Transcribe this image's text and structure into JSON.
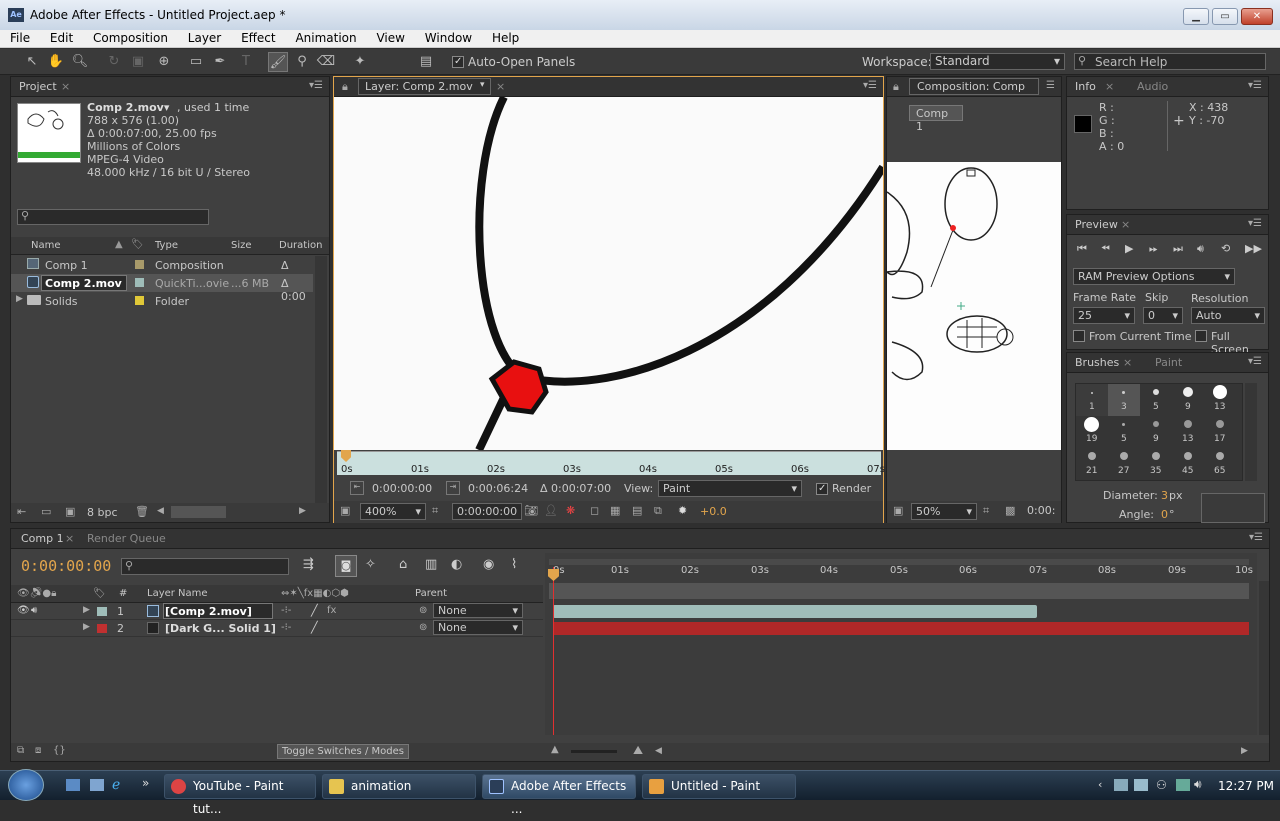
{
  "window": {
    "title": "Adobe After Effects - Untitled Project.aep *",
    "app_icon": "Ae"
  },
  "menu": [
    "File",
    "Edit",
    "Composition",
    "Layer",
    "Effect",
    "Animation",
    "View",
    "Window",
    "Help"
  ],
  "toolbar": {
    "auto_open_label": "Auto-Open Panels",
    "workspace_label": "Workspace:",
    "workspace_value": "Standard",
    "search_placeholder": "Search Help"
  },
  "project": {
    "tab": "Project",
    "item_name": "Comp 2.mov▾",
    "item_used": ", used 1 time",
    "info_lines": [
      "788 x 576 (1.00)",
      "Δ 0:00:07:00, 25.00 fps",
      "Millions of Colors",
      "MPEG-4 Video",
      "48.000 kHz / 16 bit U / Stereo"
    ],
    "columns": [
      "Name",
      "Type",
      "Size",
      "Duration"
    ],
    "rows": [
      {
        "name": "Comp 1",
        "type": "Composition",
        "size": "",
        "duration": "Δ 0:00",
        "color": "#a89a6a"
      },
      {
        "name": "Comp 2.mov",
        "type": "QuickTi...ovie",
        "size": "...6 MB",
        "duration": "Δ 0:00",
        "color": "#9fbdb9"
      },
      {
        "name": "Solids",
        "type": "Folder",
        "size": "",
        "duration": "",
        "color": "#e0c838"
      }
    ],
    "bpc": "8 bpc"
  },
  "layer_viewer": {
    "tab": "Layer: Comp 2.mov",
    "ruler": [
      "0s",
      "01s",
      "02s",
      "03s",
      "04s",
      "05s",
      "06s",
      "07s"
    ],
    "in_time": "0:00:00:00",
    "out_time": "0:00:06:24",
    "duration": "Δ 0:00:07:00",
    "view_label": "View:",
    "view_value": "Paint",
    "render_label": "Render",
    "zoom": "400%",
    "current_time": "0:00:00:00",
    "exposure": "+0.0"
  },
  "comp_viewer": {
    "tab": "Composition: Comp",
    "comp_button": "Comp 1",
    "zoom": "50%",
    "time": "0:00:"
  },
  "info": {
    "tab": "Info",
    "tab2": "Audio",
    "r": "R :",
    "g": "G :",
    "b": "B :",
    "a": "A : 0",
    "x": "X : 438",
    "y": "Y : -70"
  },
  "preview": {
    "tab": "Preview",
    "ram_options": "RAM Preview Options",
    "frame_rate_label": "Frame Rate",
    "skip_label": "Skip",
    "resolution_label": "Resolution",
    "frame_rate": "25",
    "skip": "0",
    "resolution": "Auto",
    "from_current_label": "From Current Time",
    "full_screen_label": "Full Screen"
  },
  "brushes": {
    "tab": "Brushes",
    "tab2": "Paint",
    "sizes": [
      "1",
      "3",
      "5",
      "9",
      "13",
      "19",
      "5",
      "9",
      "13",
      "17",
      "21",
      "27",
      "35",
      "45",
      "65"
    ],
    "diameter_label": "Diameter:",
    "diameter_value": "3",
    "diameter_unit": "px",
    "angle_label": "Angle:",
    "angle_value": "0",
    "angle_unit": "°"
  },
  "timeline": {
    "tab": "Comp 1",
    "tab2": "Render Queue",
    "timecode": "0:00:00:00",
    "col_num": "#",
    "col_layer": "Layer Name",
    "col_parent": "Parent",
    "ruler": [
      "0s",
      "01s",
      "02s",
      "03s",
      "04s",
      "05s",
      "06s",
      "07s",
      "08s",
      "09s",
      "10s"
    ],
    "layers": [
      {
        "num": "1",
        "name": "[Comp 2.mov]",
        "parent": "None",
        "color": "#9fbdb9"
      },
      {
        "num": "2",
        "name": "[Dark G... Solid 1]",
        "parent": "None",
        "color": "#c03030"
      }
    ],
    "toggle_label": "Toggle Switches / Modes"
  },
  "taskbar": {
    "items": [
      {
        "label": "YouTube - Paint tut...",
        "color": "#d44"
      },
      {
        "label": "animation",
        "color": "#e6c450"
      },
      {
        "label": "Adobe After Effects ...",
        "color": "#2b3e58"
      },
      {
        "label": "Untitled - Paint",
        "color": "#e8a040"
      }
    ],
    "clock": "12:27 PM"
  }
}
